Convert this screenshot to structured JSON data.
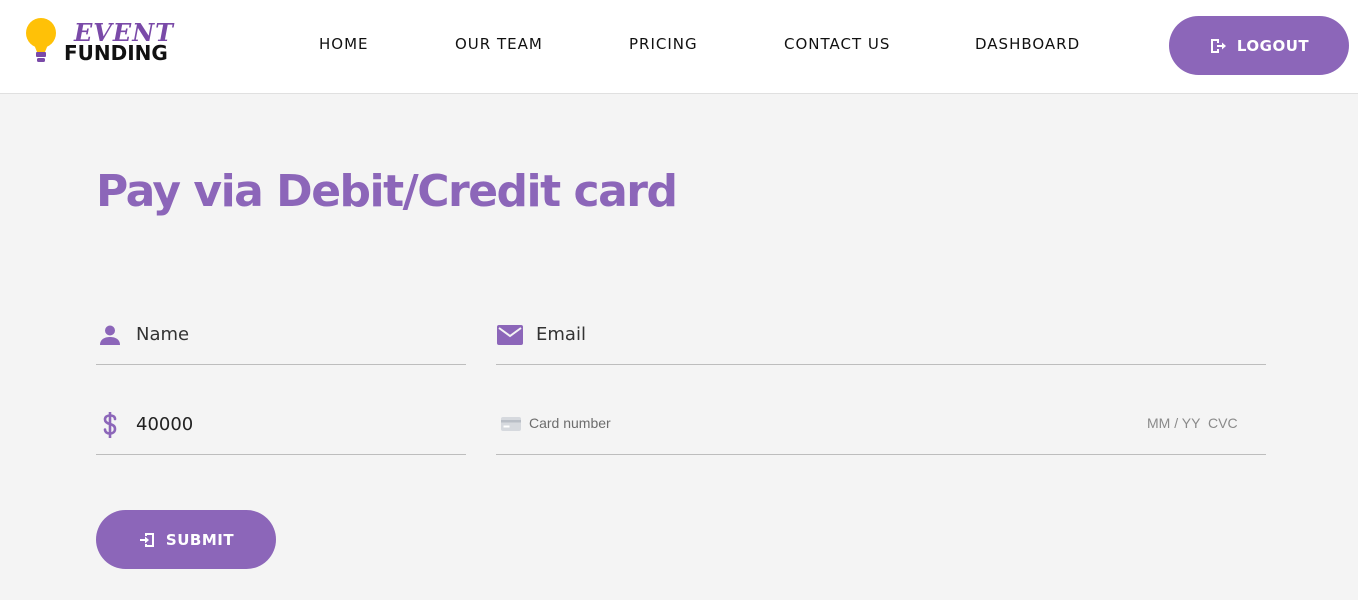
{
  "brand": {
    "line1": "EVENT",
    "line2": "FUNDING",
    "icon": "lightbulb-icon",
    "colors": {
      "bulb": "#ffc107",
      "accent": "#7a4aa8"
    }
  },
  "nav": {
    "items": [
      {
        "label": "HOME"
      },
      {
        "label": "OUR TEAM"
      },
      {
        "label": "PRICING"
      },
      {
        "label": "CONTACT US"
      },
      {
        "label": "DASHBOARD"
      }
    ],
    "logout": {
      "label": "LOGOUT",
      "icon": "logout-icon"
    }
  },
  "page": {
    "title": "Pay via Debit/Credit card"
  },
  "form": {
    "name": {
      "placeholder": "Name",
      "value": "",
      "icon": "person-icon"
    },
    "email": {
      "placeholder": "Email",
      "value": "",
      "icon": "envelope-icon"
    },
    "amount": {
      "value": "40000",
      "icon": "dollar-icon"
    },
    "card": {
      "placeholder": "Card number",
      "expiry_placeholder": "MM / YY",
      "cvc_placeholder": "CVC",
      "icon": "credit-card-icon"
    },
    "submit": {
      "label": "SUBMIT",
      "icon": "login-icon"
    }
  },
  "colors": {
    "primary": "#8c66b9",
    "background": "#f4f4f4",
    "header": "#ffffff"
  }
}
